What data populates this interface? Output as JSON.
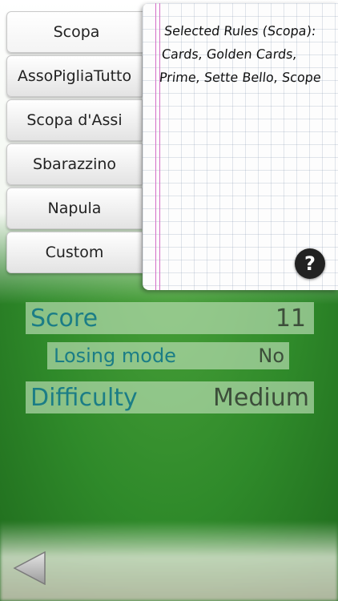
{
  "modes": [
    {
      "label": "Scopa",
      "selected": true
    },
    {
      "label": "AssoPigliaTutto",
      "selected": false
    },
    {
      "label": "Scopa d'Assi",
      "selected": false
    },
    {
      "label": "Sbarazzino",
      "selected": false
    },
    {
      "label": "Napula",
      "selected": false
    },
    {
      "label": "Custom",
      "selected": false
    }
  ],
  "rules": {
    "line1": "Selected Rules (Scopa):",
    "line2": "Cards, Golden Cards,",
    "line3": "Prime, Sette Bello,  Scope",
    "help_icon": "question-mark-icon"
  },
  "settings": {
    "score": {
      "label": "Score",
      "value": "11"
    },
    "losing_mode": {
      "label": "Losing mode",
      "value": "No"
    },
    "difficulty": {
      "label": "Difficulty",
      "value": "Medium"
    }
  },
  "nav": {
    "back_icon": "back-triangle-icon"
  },
  "colors": {
    "label": "#1b7d86",
    "value": "#3c4e3a",
    "table_green": "#2f8a2a"
  }
}
